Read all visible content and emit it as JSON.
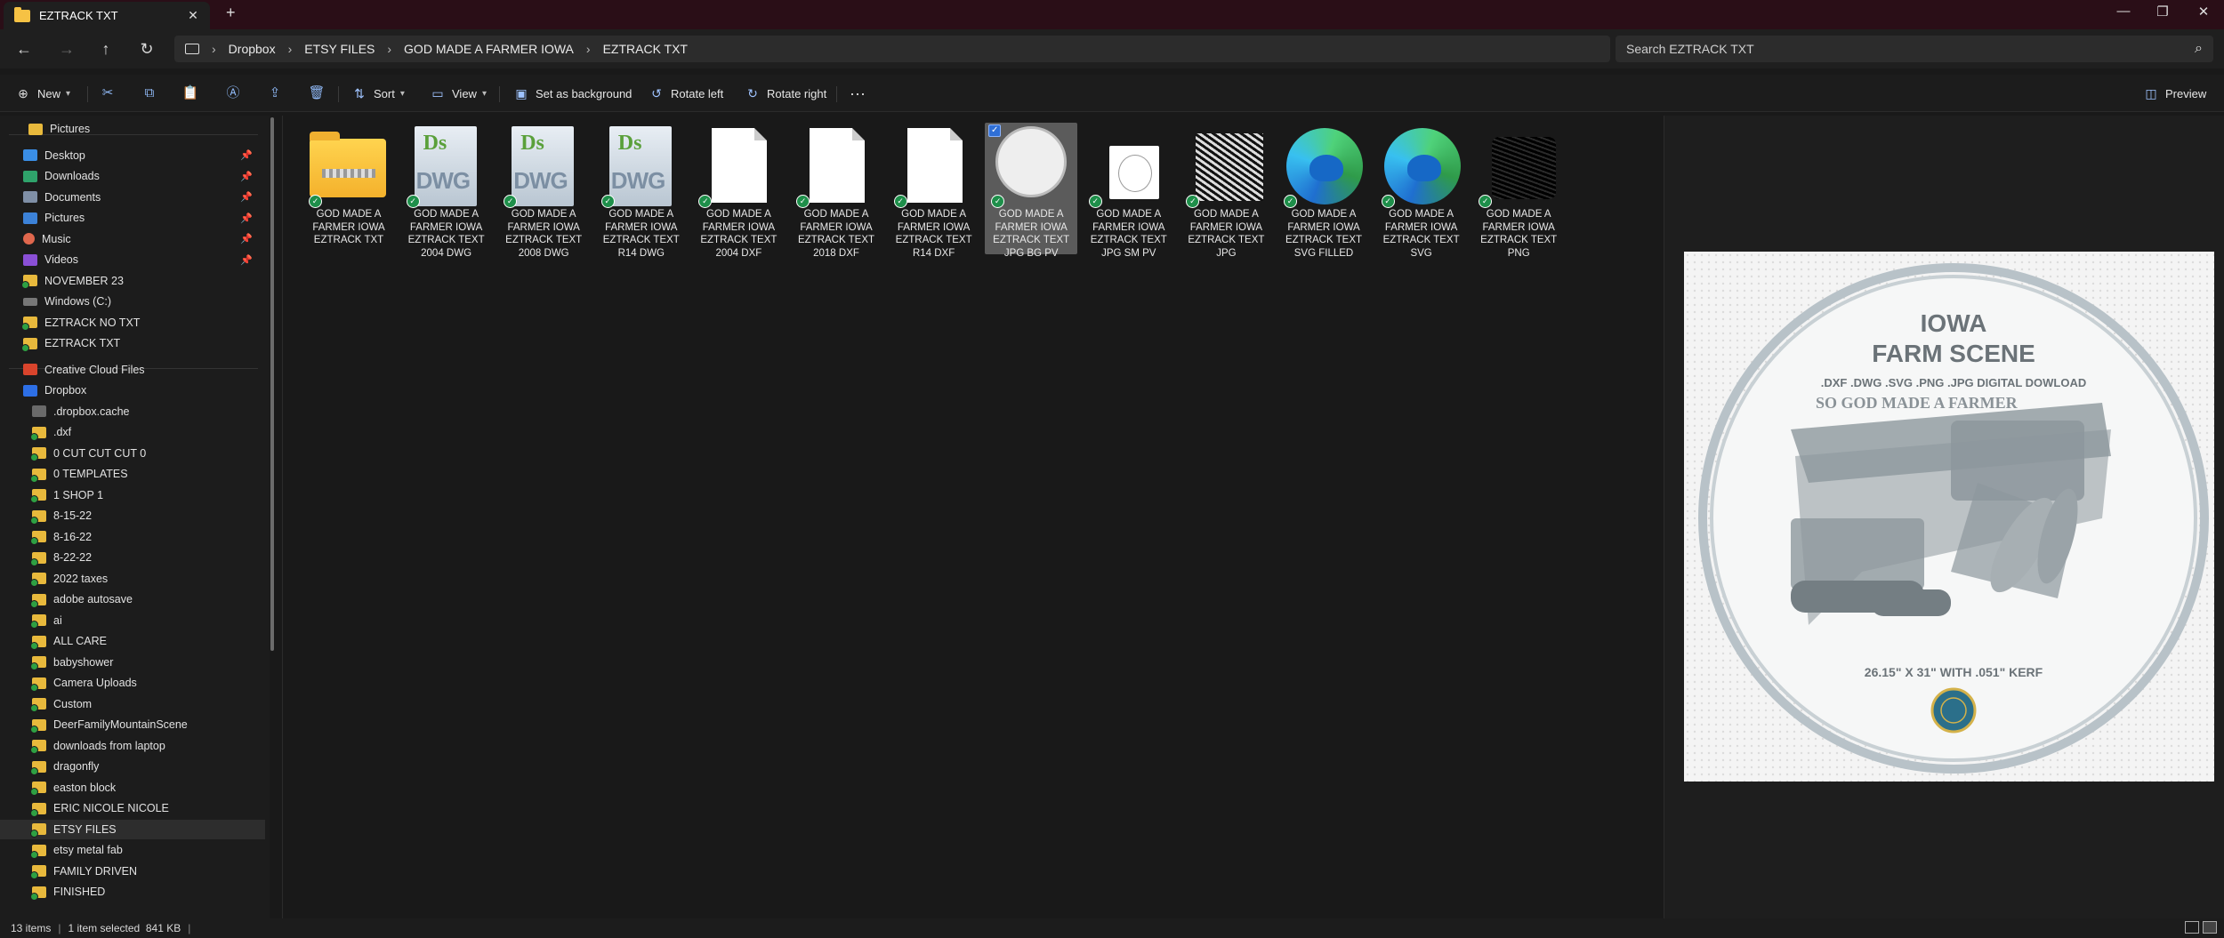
{
  "window": {
    "tab_title": "EZTRACK TXT",
    "tab_close": "✕",
    "tab_add": "+",
    "minimize": "—",
    "maximize": "❐",
    "close": "✕"
  },
  "address": {
    "back": "←",
    "forward": "→",
    "up": "↑",
    "refresh": "↻",
    "breadcrumb": [
      "Dropbox",
      "ETSY FILES",
      "GOD MADE A FARMER IOWA",
      "EZTRACK TXT"
    ],
    "sep": "›",
    "search_placeholder": "Search EZTRACK TXT",
    "search_icon": "⌕"
  },
  "toolbar": {
    "new_label": "New",
    "sort_label": "Sort",
    "view_label": "View",
    "set_background_label": "Set as background",
    "rotate_left_label": "Rotate left",
    "rotate_right_label": "Rotate right",
    "more_label": "···",
    "preview_label": "Preview",
    "icons": {
      "new": "⊕",
      "cut": "✂",
      "copy": "⧉",
      "paste": "📋",
      "rename": "Ⓐ",
      "share": "⇪",
      "delete": "🗑",
      "sort": "⇅",
      "view": "▭",
      "background": "▣",
      "rotate_left": "↺",
      "rotate_right": "↻",
      "preview": "◫"
    }
  },
  "nav": {
    "items": [
      {
        "label": "Pictures",
        "icon": "folder",
        "top": 0,
        "indent": 32
      },
      {
        "label": "Desktop",
        "icon": "desk",
        "pinned": true,
        "indent": 26
      },
      {
        "label": "Downloads",
        "icon": "down",
        "pinned": true,
        "indent": 26
      },
      {
        "label": "Documents",
        "icon": "docs",
        "pinned": true,
        "indent": 26
      },
      {
        "label": "Pictures",
        "icon": "pics",
        "pinned": true,
        "indent": 26
      },
      {
        "label": "Music",
        "icon": "music",
        "pinned": true,
        "indent": 26
      },
      {
        "label": "Videos",
        "icon": "vids",
        "pinned": true,
        "indent": 26
      },
      {
        "label": "NOVEMBER 23",
        "icon": "folder g",
        "indent": 26
      },
      {
        "label": "Windows (C:)",
        "icon": "drive",
        "indent": 26
      },
      {
        "label": "EZTRACK NO TXT",
        "icon": "folder g",
        "indent": 26
      },
      {
        "label": "EZTRACK TXT",
        "icon": "folder g",
        "indent": 26
      },
      {
        "label": "Creative Cloud Files",
        "icon": "cloud",
        "indent": 26
      },
      {
        "label": "Dropbox",
        "icon": "dropbox",
        "indent": 26
      },
      {
        "label": ".dropbox.cache",
        "icon": "grey",
        "indent": 36
      },
      {
        "label": ".dxf",
        "icon": "folder g",
        "indent": 36
      },
      {
        "label": "0 CUT CUT CUT 0",
        "icon": "folder g",
        "indent": 36
      },
      {
        "label": "0 TEMPLATES",
        "icon": "folder g",
        "indent": 36
      },
      {
        "label": "1 SHOP 1",
        "icon": "folder g",
        "indent": 36
      },
      {
        "label": "8-15-22",
        "icon": "folder g",
        "indent": 36
      },
      {
        "label": "8-16-22",
        "icon": "folder g",
        "indent": 36
      },
      {
        "label": "8-22-22",
        "icon": "folder g",
        "indent": 36
      },
      {
        "label": "2022 taxes",
        "icon": "folder g",
        "indent": 36
      },
      {
        "label": "adobe autosave",
        "icon": "folder g",
        "indent": 36
      },
      {
        "label": "ai",
        "icon": "folder g",
        "indent": 36
      },
      {
        "label": "ALL CARE",
        "icon": "folder g",
        "indent": 36
      },
      {
        "label": "babyshower",
        "icon": "folder g",
        "indent": 36
      },
      {
        "label": "Camera Uploads",
        "icon": "folder g",
        "indent": 36
      },
      {
        "label": "Custom",
        "icon": "folder g",
        "indent": 36
      },
      {
        "label": "DeerFamilyMountainScene",
        "icon": "folder g",
        "indent": 36
      },
      {
        "label": "downloads from laptop",
        "icon": "folder g",
        "indent": 36
      },
      {
        "label": "dragonfly",
        "icon": "folder g",
        "indent": 36
      },
      {
        "label": "easton block",
        "icon": "folder g",
        "indent": 36
      },
      {
        "label": "ERIC NICOLE NICOLE",
        "icon": "folder g",
        "indent": 36
      },
      {
        "label": "ETSY FILES",
        "icon": "folder g",
        "indent": 36,
        "selected": true
      },
      {
        "label": "etsy metal fab",
        "icon": "folder g",
        "indent": 36
      },
      {
        "label": "FAMILY DRIVEN",
        "icon": "folder g",
        "indent": 36
      },
      {
        "label": "FINISHED",
        "icon": "folder g",
        "indent": 36
      }
    ],
    "pin_glyph": "📌"
  },
  "files": [
    {
      "label": "GOD MADE A FARMER IOWA EZTRACK TXT",
      "kind": "zip"
    },
    {
      "label": "GOD MADE A FARMER IOWA EZTRACK TEXT 2004 DWG",
      "kind": "dwg"
    },
    {
      "label": "GOD MADE A FARMER IOWA EZTRACK TEXT 2008 DWG",
      "kind": "dwg"
    },
    {
      "label": "GOD MADE A FARMER IOWA EZTRACK TEXT R14 DWG",
      "kind": "dwg"
    },
    {
      "label": "GOD MADE A FARMER IOWA EZTRACK TEXT 2004 DXF",
      "kind": "page"
    },
    {
      "label": "GOD MADE A FARMER IOWA EZTRACK TEXT 2018 DXF",
      "kind": "page"
    },
    {
      "label": "GOD MADE A FARMER IOWA EZTRACK TEXT R14 DXF",
      "kind": "page"
    },
    {
      "label": "GOD MADE A FARMER IOWA EZTRACK TEXT JPG BG PV",
      "kind": "round",
      "selected": true
    },
    {
      "label": "GOD MADE A FARMER IOWA EZTRACK TEXT JPG SM PV",
      "kind": "small"
    },
    {
      "label": "GOD MADE A FARMER IOWA EZTRACK TEXT JPG",
      "kind": "photo"
    },
    {
      "label": "GOD MADE A FARMER IOWA EZTRACK TEXT SVG FILLED",
      "kind": "edge"
    },
    {
      "label": "GOD MADE A FARMER IOWA EZTRACK TEXT SVG",
      "kind": "edge"
    },
    {
      "label": "GOD MADE A FARMER IOWA EZTRACK TEXT PNG",
      "kind": "black"
    }
  ],
  "dwg_badge": {
    "ds": "Ds",
    "dwg": "DWG"
  },
  "preview": {
    "line1": "IOWA",
    "line2": "FARM SCENE",
    "line3": ".DXF .DWG .SVG .PNG .JPG DIGITAL DOWLOAD",
    "line4": "SO GOD MADE A FARMER",
    "line5": "26.15\" X 31\" WITH .051\" KERF"
  },
  "status": {
    "items": "13 items",
    "selection": "1 item selected  841 KB"
  }
}
